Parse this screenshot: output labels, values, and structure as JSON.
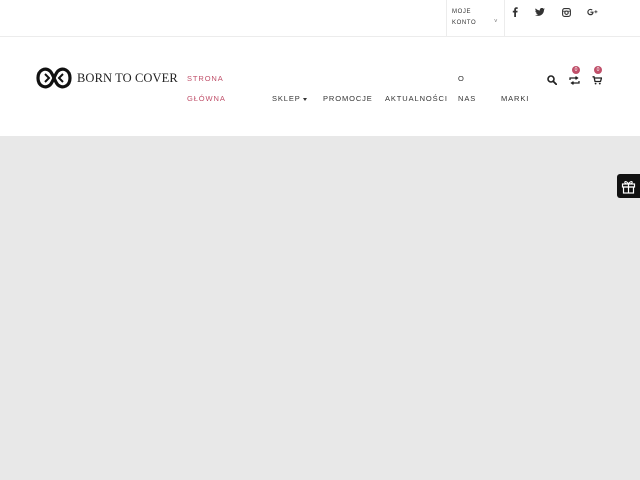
{
  "topbar": {
    "account": {
      "line1": "MOJE",
      "line2": "KONTO",
      "caret": "˅"
    },
    "social": [
      {
        "name": "facebook-icon"
      },
      {
        "name": "twitter-icon"
      },
      {
        "name": "instagram-icon"
      },
      {
        "name": "google-plus-icon"
      }
    ]
  },
  "header": {
    "logo_text": "BORN TO COVER",
    "nav": {
      "home_line1": "STRONA",
      "home_line2": "GŁÓWNA",
      "shop": "SKLEP",
      "promotions": "PROMOCJE",
      "news": "AKTUALNOŚCI",
      "about_line1": "O",
      "about_line2": "NAS",
      "brands": "MARKI"
    },
    "wishlist_count": "0",
    "cart_count": "0"
  },
  "colors": {
    "accent": "#c0506a",
    "main_background": "#e8e8e8",
    "text": "#333333"
  }
}
